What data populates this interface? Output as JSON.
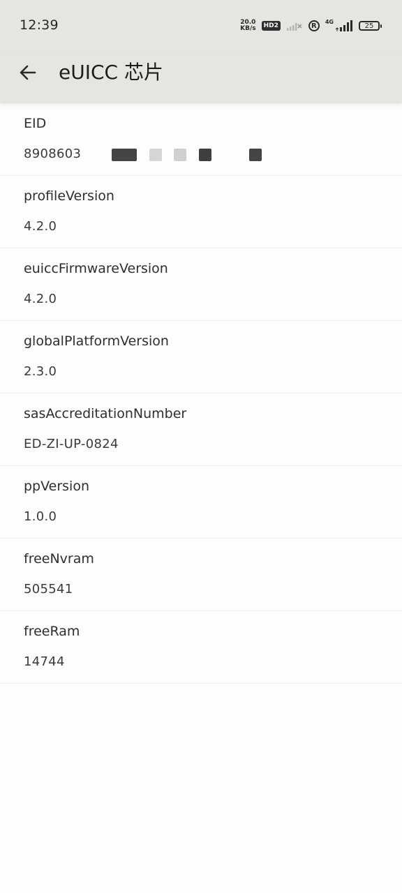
{
  "status_bar": {
    "time": "12:39",
    "net_speed_value": "20.0",
    "net_speed_unit": "KB/s",
    "hd_badge": "HD2",
    "roaming_symbol": "R",
    "network_type": "4G",
    "battery_level": "25"
  },
  "app_bar": {
    "back_icon": "arrow-left-icon",
    "title": "eUICC 芯片"
  },
  "fields": [
    {
      "label": "EID",
      "value": "8908603"
    },
    {
      "label": "profileVersion",
      "value": "4.2.0"
    },
    {
      "label": "euiccFirmwareVersion",
      "value": "4.2.0"
    },
    {
      "label": "globalPlatformVersion",
      "value": "2.3.0"
    },
    {
      "label": "sasAccreditationNumber",
      "value": "ED-ZI-UP-0824"
    },
    {
      "label": "ppVersion",
      "value": "1.0.0"
    },
    {
      "label": "freeNvram",
      "value": "505541"
    },
    {
      "label": "freeRam",
      "value": "14744"
    }
  ]
}
